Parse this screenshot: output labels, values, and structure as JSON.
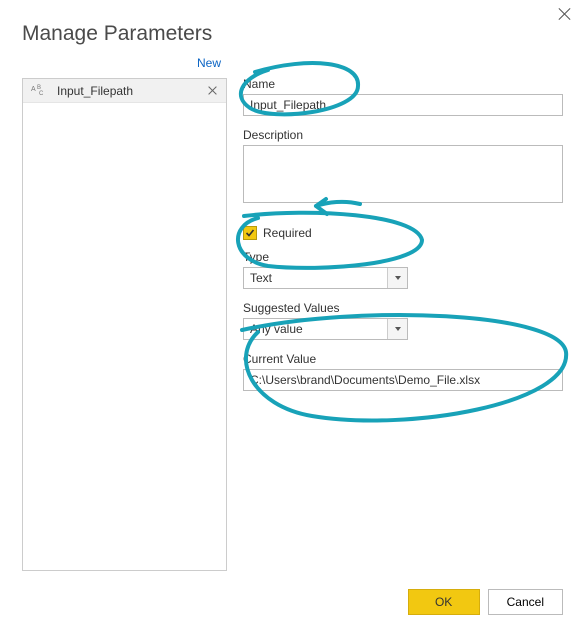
{
  "dialog": {
    "title": "Manage Parameters",
    "new_link": "New"
  },
  "param_list": {
    "items": [
      {
        "label": "Input_Filepath"
      }
    ]
  },
  "fields": {
    "name_label": "Name",
    "name_value": "Input_Filepath",
    "description_label": "Description",
    "description_value": "",
    "required_label": "Required",
    "required_checked": true,
    "type_label": "Type",
    "type_value": "Text",
    "suggested_label": "Suggested Values",
    "suggested_value": "Any value",
    "current_label": "Current Value",
    "current_value": "C:\\Users\\brand\\Documents\\Demo_File.xlsx"
  },
  "buttons": {
    "ok": "OK",
    "cancel": "Cancel"
  }
}
